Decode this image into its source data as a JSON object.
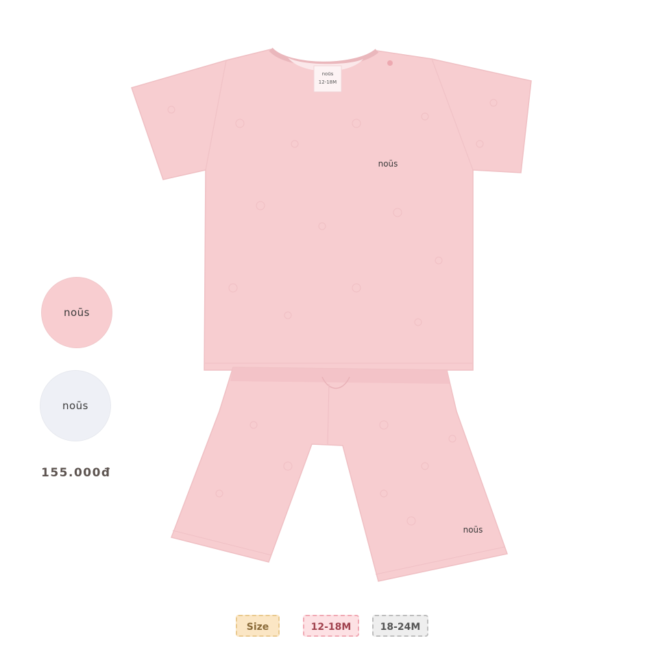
{
  "product": {
    "brand_logo_text": "noūs",
    "label_size_text": "12-18M",
    "price": "155.000đ"
  },
  "colors": {
    "options": [
      {
        "name": "pink",
        "hex": "#f8cdd0",
        "logo": "noūs"
      },
      {
        "name": "white",
        "hex": "#eef0f6",
        "logo": "noūs"
      }
    ],
    "garment": "#f7cdd0"
  },
  "sizes": {
    "label": "Size",
    "options": [
      "12-18M",
      "18-24M"
    ]
  }
}
